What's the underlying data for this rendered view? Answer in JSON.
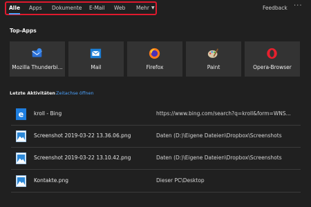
{
  "tabs": [
    {
      "label": "Alle",
      "active": true
    },
    {
      "label": "Apps"
    },
    {
      "label": "Dokumente"
    },
    {
      "label": "E-Mail"
    },
    {
      "label": "Web"
    },
    {
      "label": "Mehr"
    }
  ],
  "header": {
    "feedback_label": "Feedback",
    "more_options_label": "···"
  },
  "top_apps": {
    "title": "Top-Apps",
    "items": [
      {
        "label": "Mozilla Thunderbi...",
        "icon": "thunderbird-icon"
      },
      {
        "label": "Mail",
        "icon": "mail-icon"
      },
      {
        "label": "Firefox",
        "icon": "firefox-icon"
      },
      {
        "label": "Paint",
        "icon": "paint-icon"
      },
      {
        "label": "Opera-Browser",
        "icon": "opera-icon"
      }
    ]
  },
  "recent": {
    "title": "Letzte Aktivitäten",
    "timeline_link": "Zeitachse öffnen",
    "items": [
      {
        "name": "kroll - Bing",
        "path": "https://www.bing.com/search?q=kroll&form=WNS...",
        "icon": "edge-icon"
      },
      {
        "name": "Screenshot 2019-03-22 13.36.06.png",
        "path": "Daten (D:)\\Eigene Dateien\\Dropbox\\Screenshots",
        "icon": "image-file-icon"
      },
      {
        "name": "Screenshot 2019-03-22 13.10.42.png",
        "path": "Daten (D:)\\Eigene Dateien\\Dropbox\\Screenshots",
        "icon": "image-file-icon"
      },
      {
        "name": "Kontakte.png",
        "path": "Dieser PC\\Desktop",
        "icon": "image-file-icon"
      }
    ]
  },
  "colors": {
    "accent": "#4ca3ff",
    "highlight": "#e0192d",
    "background": "#202020",
    "tile": "#333333"
  }
}
